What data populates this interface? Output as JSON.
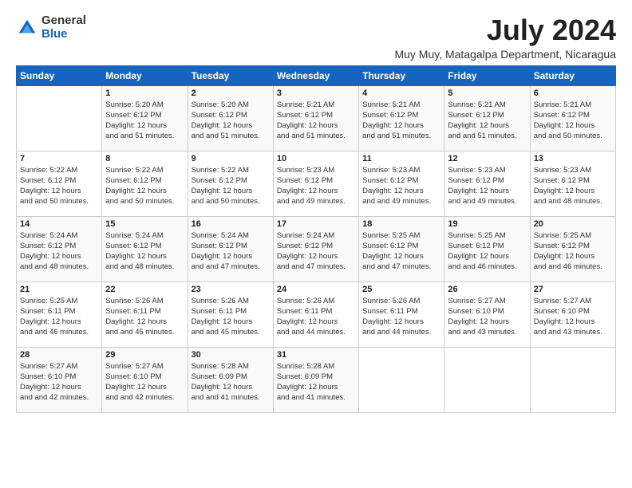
{
  "logo": {
    "general": "General",
    "blue": "Blue"
  },
  "title": {
    "month_year": "July 2024",
    "location": "Muy Muy, Matagalpa Department, Nicaragua"
  },
  "days_of_week": [
    "Sunday",
    "Monday",
    "Tuesday",
    "Wednesday",
    "Thursday",
    "Friday",
    "Saturday"
  ],
  "weeks": [
    [
      {
        "day": "",
        "sunrise": "",
        "sunset": "",
        "daylight": ""
      },
      {
        "day": "1",
        "sunrise": "Sunrise: 5:20 AM",
        "sunset": "Sunset: 6:12 PM",
        "daylight": "Daylight: 12 hours and 51 minutes."
      },
      {
        "day": "2",
        "sunrise": "Sunrise: 5:20 AM",
        "sunset": "Sunset: 6:12 PM",
        "daylight": "Daylight: 12 hours and 51 minutes."
      },
      {
        "day": "3",
        "sunrise": "Sunrise: 5:21 AM",
        "sunset": "Sunset: 6:12 PM",
        "daylight": "Daylight: 12 hours and 51 minutes."
      },
      {
        "day": "4",
        "sunrise": "Sunrise: 5:21 AM",
        "sunset": "Sunset: 6:12 PM",
        "daylight": "Daylight: 12 hours and 51 minutes."
      },
      {
        "day": "5",
        "sunrise": "Sunrise: 5:21 AM",
        "sunset": "Sunset: 6:12 PM",
        "daylight": "Daylight: 12 hours and 51 minutes."
      },
      {
        "day": "6",
        "sunrise": "Sunrise: 5:21 AM",
        "sunset": "Sunset: 6:12 PM",
        "daylight": "Daylight: 12 hours and 50 minutes."
      }
    ],
    [
      {
        "day": "7",
        "sunrise": "Sunrise: 5:22 AM",
        "sunset": "Sunset: 6:12 PM",
        "daylight": "Daylight: 12 hours and 50 minutes."
      },
      {
        "day": "8",
        "sunrise": "Sunrise: 5:22 AM",
        "sunset": "Sunset: 6:12 PM",
        "daylight": "Daylight: 12 hours and 50 minutes."
      },
      {
        "day": "9",
        "sunrise": "Sunrise: 5:22 AM",
        "sunset": "Sunset: 6:12 PM",
        "daylight": "Daylight: 12 hours and 50 minutes."
      },
      {
        "day": "10",
        "sunrise": "Sunrise: 5:23 AM",
        "sunset": "Sunset: 6:12 PM",
        "daylight": "Daylight: 12 hours and 49 minutes."
      },
      {
        "day": "11",
        "sunrise": "Sunrise: 5:23 AM",
        "sunset": "Sunset: 6:12 PM",
        "daylight": "Daylight: 12 hours and 49 minutes."
      },
      {
        "day": "12",
        "sunrise": "Sunrise: 5:23 AM",
        "sunset": "Sunset: 6:12 PM",
        "daylight": "Daylight: 12 hours and 49 minutes."
      },
      {
        "day": "13",
        "sunrise": "Sunrise: 5:23 AM",
        "sunset": "Sunset: 6:12 PM",
        "daylight": "Daylight: 12 hours and 48 minutes."
      }
    ],
    [
      {
        "day": "14",
        "sunrise": "Sunrise: 5:24 AM",
        "sunset": "Sunset: 6:12 PM",
        "daylight": "Daylight: 12 hours and 48 minutes."
      },
      {
        "day": "15",
        "sunrise": "Sunrise: 5:24 AM",
        "sunset": "Sunset: 6:12 PM",
        "daylight": "Daylight: 12 hours and 48 minutes."
      },
      {
        "day": "16",
        "sunrise": "Sunrise: 5:24 AM",
        "sunset": "Sunset: 6:12 PM",
        "daylight": "Daylight: 12 hours and 47 minutes."
      },
      {
        "day": "17",
        "sunrise": "Sunrise: 5:24 AM",
        "sunset": "Sunset: 6:12 PM",
        "daylight": "Daylight: 12 hours and 47 minutes."
      },
      {
        "day": "18",
        "sunrise": "Sunrise: 5:25 AM",
        "sunset": "Sunset: 6:12 PM",
        "daylight": "Daylight: 12 hours and 47 minutes."
      },
      {
        "day": "19",
        "sunrise": "Sunrise: 5:25 AM",
        "sunset": "Sunset: 6:12 PM",
        "daylight": "Daylight: 12 hours and 46 minutes."
      },
      {
        "day": "20",
        "sunrise": "Sunrise: 5:25 AM",
        "sunset": "Sunset: 6:12 PM",
        "daylight": "Daylight: 12 hours and 46 minutes."
      }
    ],
    [
      {
        "day": "21",
        "sunrise": "Sunrise: 5:25 AM",
        "sunset": "Sunset: 6:11 PM",
        "daylight": "Daylight: 12 hours and 46 minutes."
      },
      {
        "day": "22",
        "sunrise": "Sunrise: 5:26 AM",
        "sunset": "Sunset: 6:11 PM",
        "daylight": "Daylight: 12 hours and 45 minutes."
      },
      {
        "day": "23",
        "sunrise": "Sunrise: 5:26 AM",
        "sunset": "Sunset: 6:11 PM",
        "daylight": "Daylight: 12 hours and 45 minutes."
      },
      {
        "day": "24",
        "sunrise": "Sunrise: 5:26 AM",
        "sunset": "Sunset: 6:11 PM",
        "daylight": "Daylight: 12 hours and 44 minutes."
      },
      {
        "day": "25",
        "sunrise": "Sunrise: 5:26 AM",
        "sunset": "Sunset: 6:11 PM",
        "daylight": "Daylight: 12 hours and 44 minutes."
      },
      {
        "day": "26",
        "sunrise": "Sunrise: 5:27 AM",
        "sunset": "Sunset: 6:10 PM",
        "daylight": "Daylight: 12 hours and 43 minutes."
      },
      {
        "day": "27",
        "sunrise": "Sunrise: 5:27 AM",
        "sunset": "Sunset: 6:10 PM",
        "daylight": "Daylight: 12 hours and 43 minutes."
      }
    ],
    [
      {
        "day": "28",
        "sunrise": "Sunrise: 5:27 AM",
        "sunset": "Sunset: 6:10 PM",
        "daylight": "Daylight: 12 hours and 42 minutes."
      },
      {
        "day": "29",
        "sunrise": "Sunrise: 5:27 AM",
        "sunset": "Sunset: 6:10 PM",
        "daylight": "Daylight: 12 hours and 42 minutes."
      },
      {
        "day": "30",
        "sunrise": "Sunrise: 5:28 AM",
        "sunset": "Sunset: 6:09 PM",
        "daylight": "Daylight: 12 hours and 41 minutes."
      },
      {
        "day": "31",
        "sunrise": "Sunrise: 5:28 AM",
        "sunset": "Sunset: 6:09 PM",
        "daylight": "Daylight: 12 hours and 41 minutes."
      },
      {
        "day": "",
        "sunrise": "",
        "sunset": "",
        "daylight": ""
      },
      {
        "day": "",
        "sunrise": "",
        "sunset": "",
        "daylight": ""
      },
      {
        "day": "",
        "sunrise": "",
        "sunset": "",
        "daylight": ""
      }
    ]
  ]
}
